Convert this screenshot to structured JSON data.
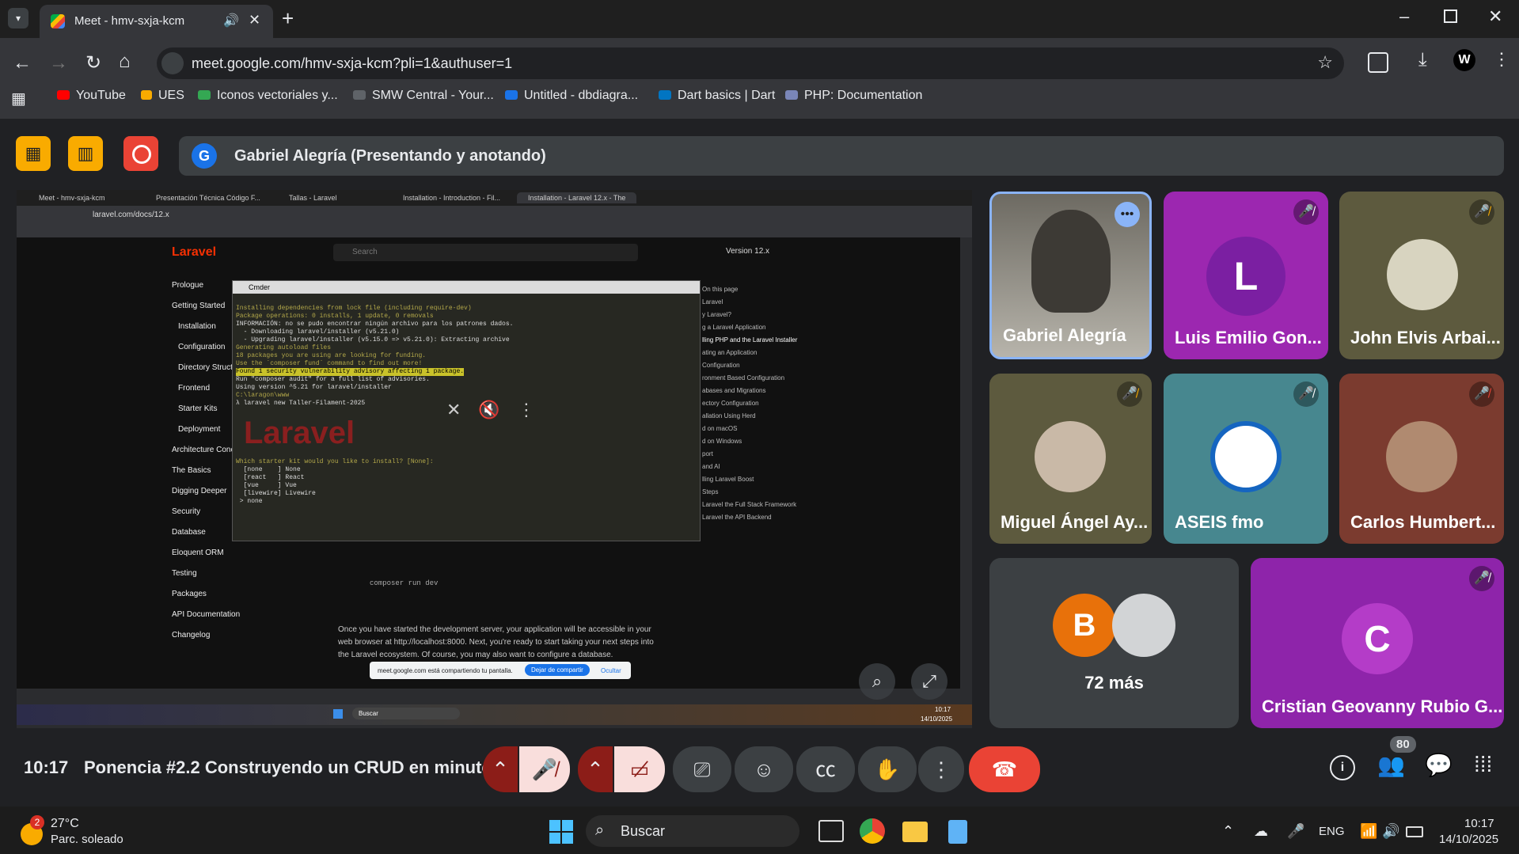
{
  "browser": {
    "tab_title": "Meet - hmv-sxja-kcm",
    "url": "meet.google.com/hmv-sxja-kcm?pli=1&authuser=1",
    "bookmarks": [
      "YouTube",
      "UES",
      "Iconos vectoriales y...",
      "SMW Central - Your...",
      "Untitled - dbdiagra...",
      "Dart basics | Dart",
      "PHP: Documentation"
    ]
  },
  "meet": {
    "presenter_banner": "Gabriel Alegría (Presentando y anotando)",
    "presenter_initial": "G",
    "time": "10:17",
    "meeting_title": "Ponencia #2.2 Construyendo un CRUD en minuto...",
    "participant_count": "80",
    "participants": [
      {
        "name": "Gabriel Alegría",
        "initial": ""
      },
      {
        "name": "Luis Emilio Gon...",
        "initial": "L"
      },
      {
        "name": "John Elvis Arbai...",
        "initial": ""
      },
      {
        "name": "Miguel Ángel Ay...",
        "initial": ""
      },
      {
        "name": "ASEIS fmo",
        "initial": ""
      },
      {
        "name": "Carlos Humbert...",
        "initial": ""
      },
      {
        "name": "Cristian Geovanny Rubio G...",
        "initial": "C"
      }
    ],
    "more_tile": {
      "label": "72 más",
      "initial": "B"
    }
  },
  "shared": {
    "tabs": [
      "Meet - hmv-sxja-kcm",
      "Presentación Técnica Código F...",
      "Tallas - Laravel",
      "Installation - Introduction - Fil...",
      "Installation - Laravel 12.x - The"
    ],
    "url": "laravel.com/docs/12.x",
    "logo": "Laravel",
    "search": "Search",
    "version": "Version 12.x",
    "nav": [
      "Prologue",
      "Getting Started",
      "Installation",
      "Configuration",
      "Directory Structu",
      "Frontend",
      "Starter Kits",
      "Deployment",
      "Architecture Conc",
      "The Basics",
      "Digging Deeper",
      "Security",
      "Database",
      "Eloquent ORM",
      "Testing",
      "Packages",
      "API Documentation",
      "Changelog"
    ],
    "terminal_title": "Cmder",
    "terminal_lines": [
      "Installing dependencies from lock file (including require-dev)",
      "Package operations: 0 installs, 1 update, 0 removals",
      "INFORMACIÓN: no se pudo encontrar ningún archivo para los patrones dados.",
      "  - Downloading laravel/installer (v5.21.0)",
      "  - Upgrading laravel/installer (v5.15.0 => v5.21.0): Extracting archive",
      "Generating autoload files",
      "18 packages you are using are looking for funding.",
      "Use the `composer fund` command to find out more!",
      "Found 1 security vulnerability advisory affecting 1 package.",
      "Run \"composer audit\" for a full list of advisories.",
      "Using version ^5.21 for laravel/installer",
      "",
      "C:\\laragon\\www",
      "λ laravel new Taller-Filament-2025",
      "",
      "Which starter kit would you like to install? [None]:",
      "  [none    ] None",
      "  [react   ] React",
      "  [vue     ] Vue",
      "  [livewire] Livewire",
      " > none"
    ],
    "paragraph": "Once you have started the development server, your application will be accessible in your web browser at http://localhost:8000. Next, you're ready to start taking your next steps into the Laravel ecosystem. Of course, you may also want to configure a database.",
    "share_notice": "meet.google.com está compartiendo tu pantalla.",
    "stop_share": "Dejar de compartir",
    "hide": "Ocultar",
    "toc": [
      "On this page",
      "Laravel",
      "y Laravel?",
      "g a Laravel Application",
      "lling PHP and the Laravel Installer",
      "ating an Application",
      "Configuration",
      "ronment Based Configuration",
      "abases and Migrations",
      "ectory Configuration",
      "allation Using Herd",
      "d on macOS",
      "d on Windows",
      "port",
      "and AI",
      "lling Laravel Boost",
      "Steps",
      "Laravel the Full Stack Framework",
      "Laravel the API Backend"
    ],
    "inner_taskbar_search": "Buscar",
    "inner_clock": "10:17",
    "inner_date": "14/10/2025",
    "composer_cmd": "composer run dev"
  },
  "taskbar": {
    "weather_temp": "27°C",
    "weather_desc": "Parc. soleado",
    "weather_badge": "2",
    "search": "Buscar",
    "lang": "ENG",
    "clock": "10:17",
    "date": "14/10/2025"
  }
}
